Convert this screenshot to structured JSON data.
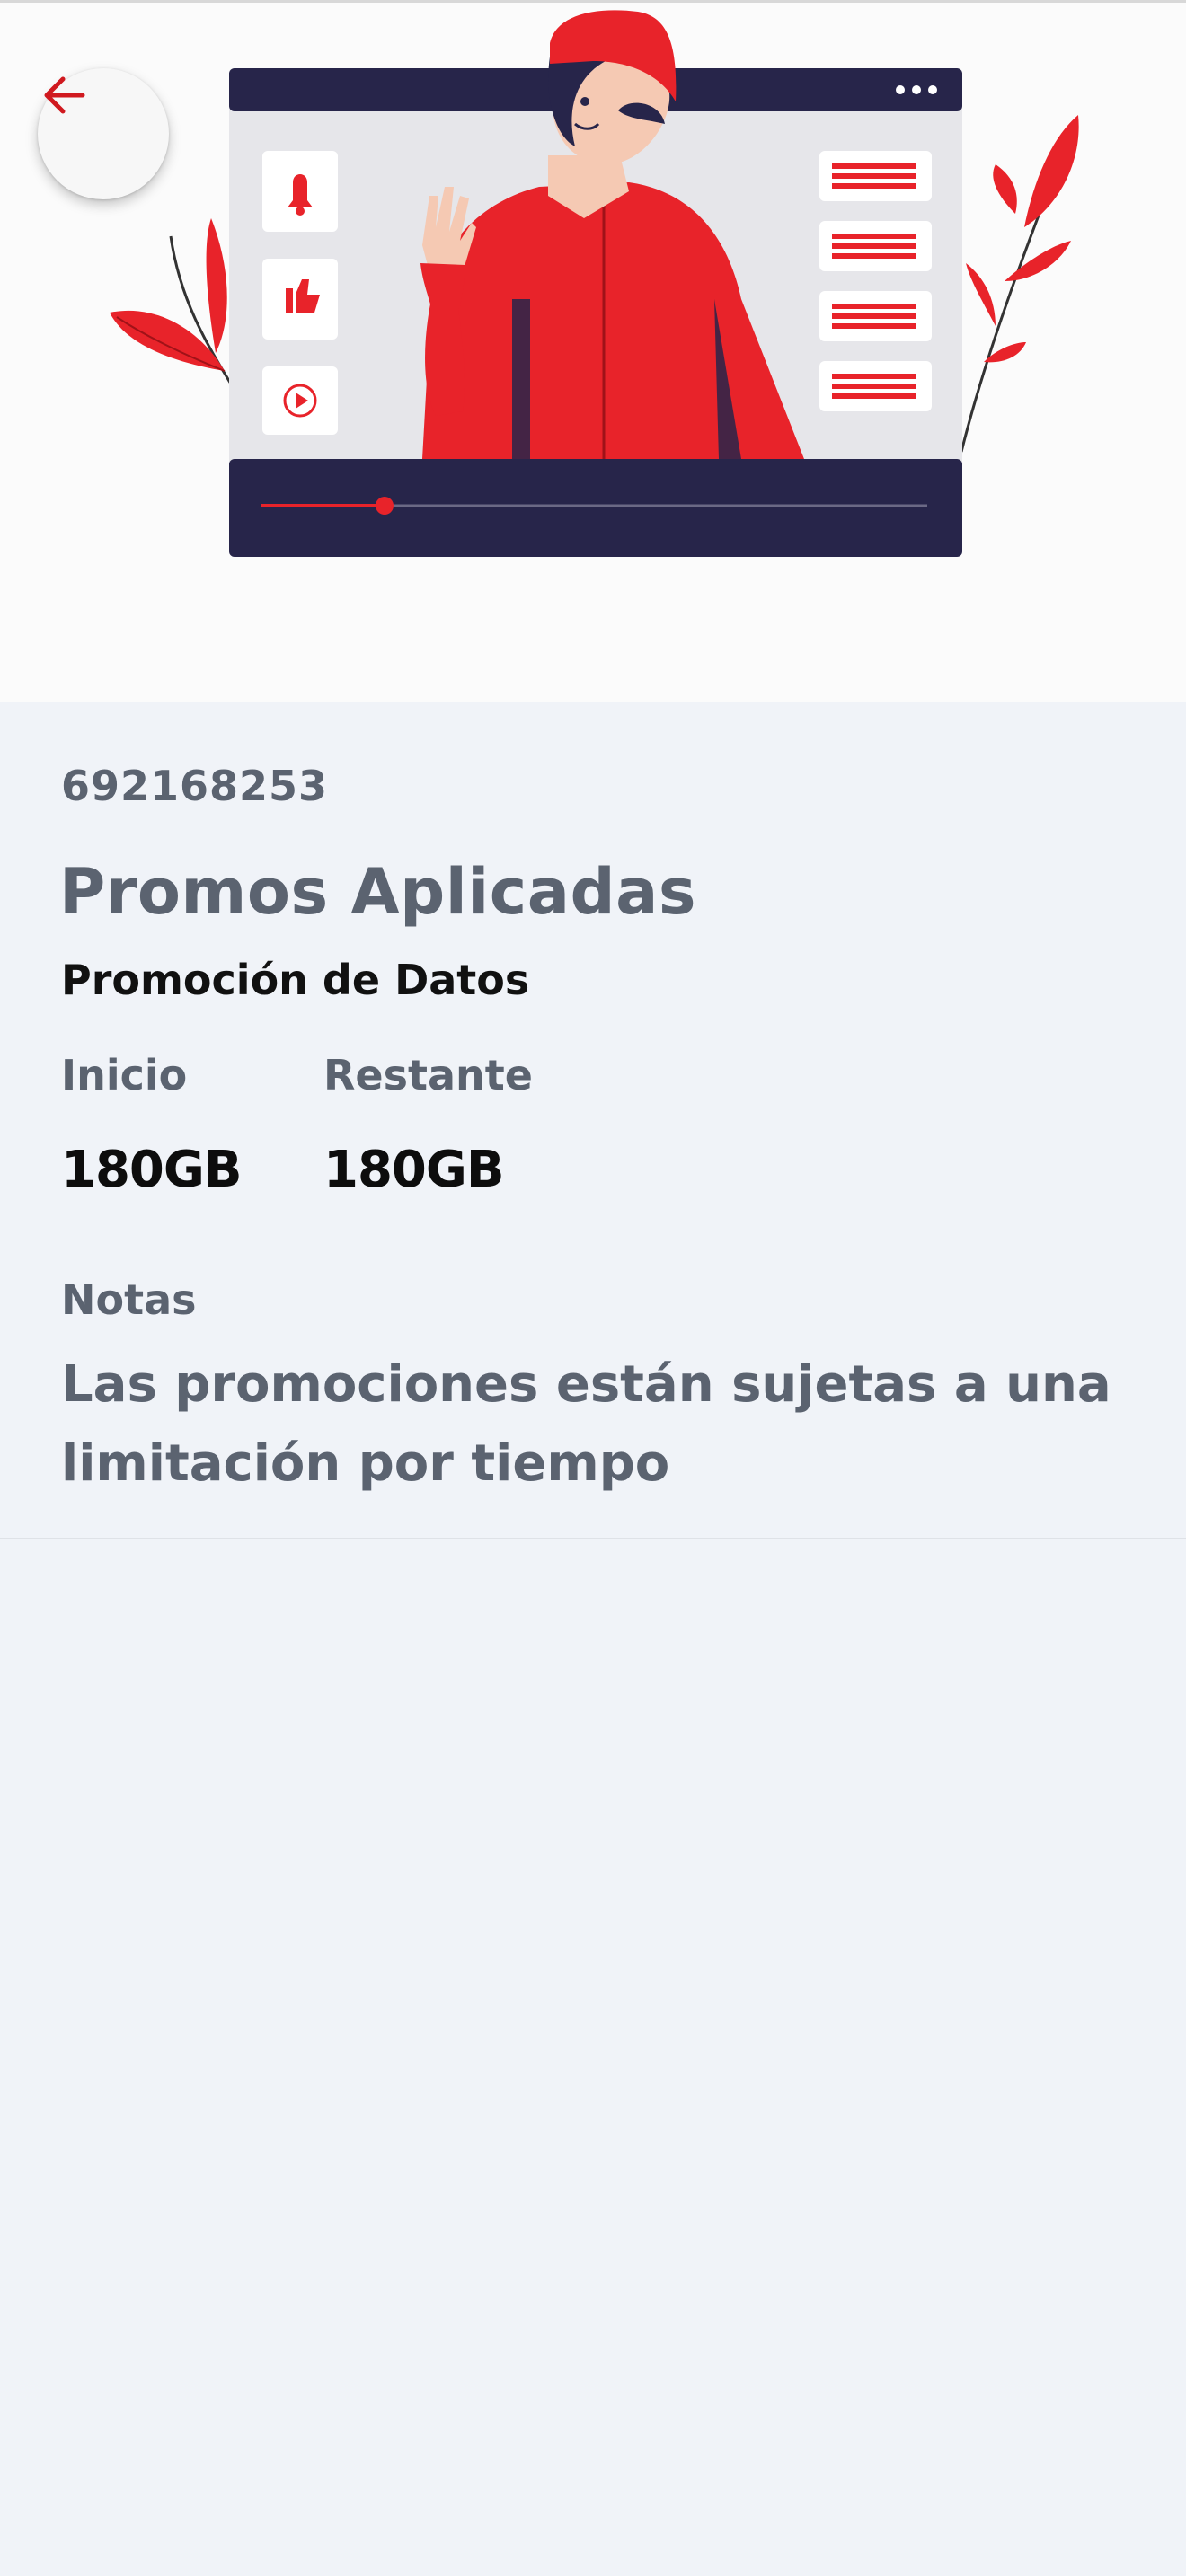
{
  "header": {
    "back_icon": "arrow-left-icon",
    "illustration": "video-presenter-illustration",
    "accent_color": "#e8232a",
    "dark_color": "#27254a"
  },
  "promo": {
    "line_number": "692168253",
    "section_title": "Promos Aplicadas",
    "name": "Promoción de Datos",
    "start_label": "Inicio",
    "start_value": "180GB",
    "remaining_label": "Restante",
    "remaining_value": "180GB",
    "notes_label": "Notas",
    "notes_text": "Las promociones están sujetas a una limitación por tiempo"
  }
}
